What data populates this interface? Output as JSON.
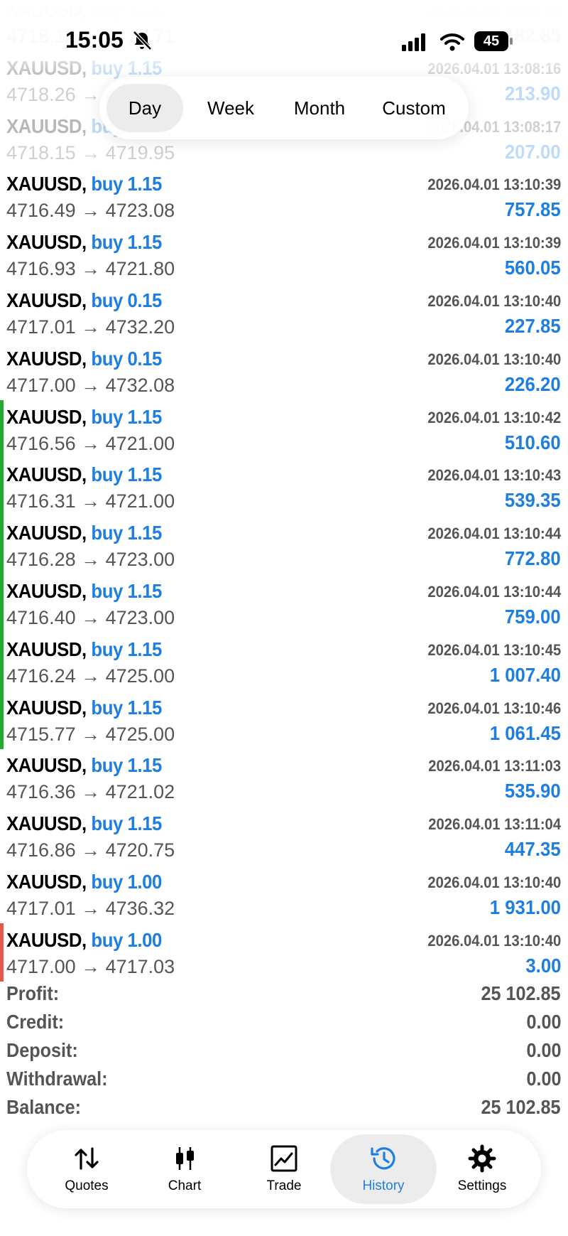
{
  "status_bar": {
    "time": "15:05",
    "battery": "45"
  },
  "period_tabs": [
    "Day",
    "Week",
    "Month",
    "Custom"
  ],
  "active_tab": "Day",
  "deals": [
    {
      "symbol": "XAUUSD,",
      "direction": "buy 1.15",
      "time": "2026.04.01 13:08:15",
      "prices": "4718.12 → 4719.71",
      "profit": "182.85",
      "faded": true
    },
    {
      "symbol": "XAUUSD,",
      "direction": "buy 1.15",
      "time": "2026.04.01 13:08:16",
      "prices": "4718.26 → 4720.12",
      "profit": "213.90",
      "faded": true
    },
    {
      "symbol": "XAUUSD,",
      "direction": "buy 1.15",
      "time": "2026.04.01 13:08:17",
      "prices": "4718.15 → 4719.95",
      "profit": "207.00",
      "faded": true
    },
    {
      "symbol": "XAUUSD,",
      "direction": "buy 1.15",
      "time": "2026.04.01 13:10:39",
      "prices": "4716.49 → 4723.08",
      "profit": "757.85"
    },
    {
      "symbol": "XAUUSD,",
      "direction": "buy 1.15",
      "time": "2026.04.01 13:10:39",
      "prices": "4716.93 → 4721.80",
      "profit": "560.05"
    },
    {
      "symbol": "XAUUSD,",
      "direction": "buy 0.15",
      "time": "2026.04.01 13:10:40",
      "prices": "4717.01 → 4732.20",
      "profit": "227.85"
    },
    {
      "symbol": "XAUUSD,",
      "direction": "buy 0.15",
      "time": "2026.04.01 13:10:40",
      "prices": "4717.00 → 4732.08",
      "profit": "226.20"
    },
    {
      "symbol": "XAUUSD,",
      "direction": "buy 1.15",
      "time": "2026.04.01 13:10:42",
      "prices": "4716.56 → 4721.00",
      "profit": "510.60",
      "marker": "#22aa33"
    },
    {
      "symbol": "XAUUSD,",
      "direction": "buy 1.15",
      "time": "2026.04.01 13:10:43",
      "prices": "4716.31 → 4721.00",
      "profit": "539.35",
      "marker": "#22aa33"
    },
    {
      "symbol": "XAUUSD,",
      "direction": "buy 1.15",
      "time": "2026.04.01 13:10:44",
      "prices": "4716.28 → 4723.00",
      "profit": "772.80",
      "marker": "#22aa33"
    },
    {
      "symbol": "XAUUSD,",
      "direction": "buy 1.15",
      "time": "2026.04.01 13:10:44",
      "prices": "4716.40 → 4723.00",
      "profit": "759.00",
      "marker": "#22aa33"
    },
    {
      "symbol": "XAUUSD,",
      "direction": "buy 1.15",
      "time": "2026.04.01 13:10:45",
      "prices": "4716.24 → 4725.00",
      "profit": "1 007.40",
      "marker": "#22aa33"
    },
    {
      "symbol": "XAUUSD,",
      "direction": "buy 1.15",
      "time": "2026.04.01 13:10:46",
      "prices": "4715.77 → 4725.00",
      "profit": "1 061.45",
      "marker": "#22aa33"
    },
    {
      "symbol": "XAUUSD,",
      "direction": "buy 1.15",
      "time": "2026.04.01 13:11:03",
      "prices": "4716.36 → 4721.02",
      "profit": "535.90"
    },
    {
      "symbol": "XAUUSD,",
      "direction": "buy 1.15",
      "time": "2026.04.01 13:11:04",
      "prices": "4716.86 → 4720.75",
      "profit": "447.35"
    },
    {
      "symbol": "XAUUSD,",
      "direction": "buy 1.00",
      "time": "2026.04.01 13:10:40",
      "prices": "4717.01 → 4736.32",
      "profit": "1 931.00"
    },
    {
      "symbol": "XAUUSD,",
      "direction": "buy 1.00",
      "time": "2026.04.01 13:10:40",
      "prices": "4717.00 → 4717.03",
      "profit": "3.00",
      "marker": "#e05a4f"
    }
  ],
  "summary": [
    {
      "label": "Profit:",
      "value": "25 102.85"
    },
    {
      "label": "Credit:",
      "value": "0.00"
    },
    {
      "label": "Deposit:",
      "value": "0.00"
    },
    {
      "label": "Withdrawal:",
      "value": "0.00"
    },
    {
      "label": "Balance:",
      "value": "25 102.85"
    }
  ],
  "nav": [
    {
      "label": "Quotes",
      "icon": "quotes-arrows-icon"
    },
    {
      "label": "Chart",
      "icon": "candlestick-icon"
    },
    {
      "label": "Trade",
      "icon": "trade-chart-icon"
    },
    {
      "label": "History",
      "icon": "history-clock-icon",
      "active": true
    },
    {
      "label": "Settings",
      "icon": "gear-icon"
    }
  ],
  "colors": {
    "accent": "#1e7fe0",
    "text_secondary": "#555555",
    "marker_green": "#22aa33",
    "marker_red": "#e05a4f"
  }
}
